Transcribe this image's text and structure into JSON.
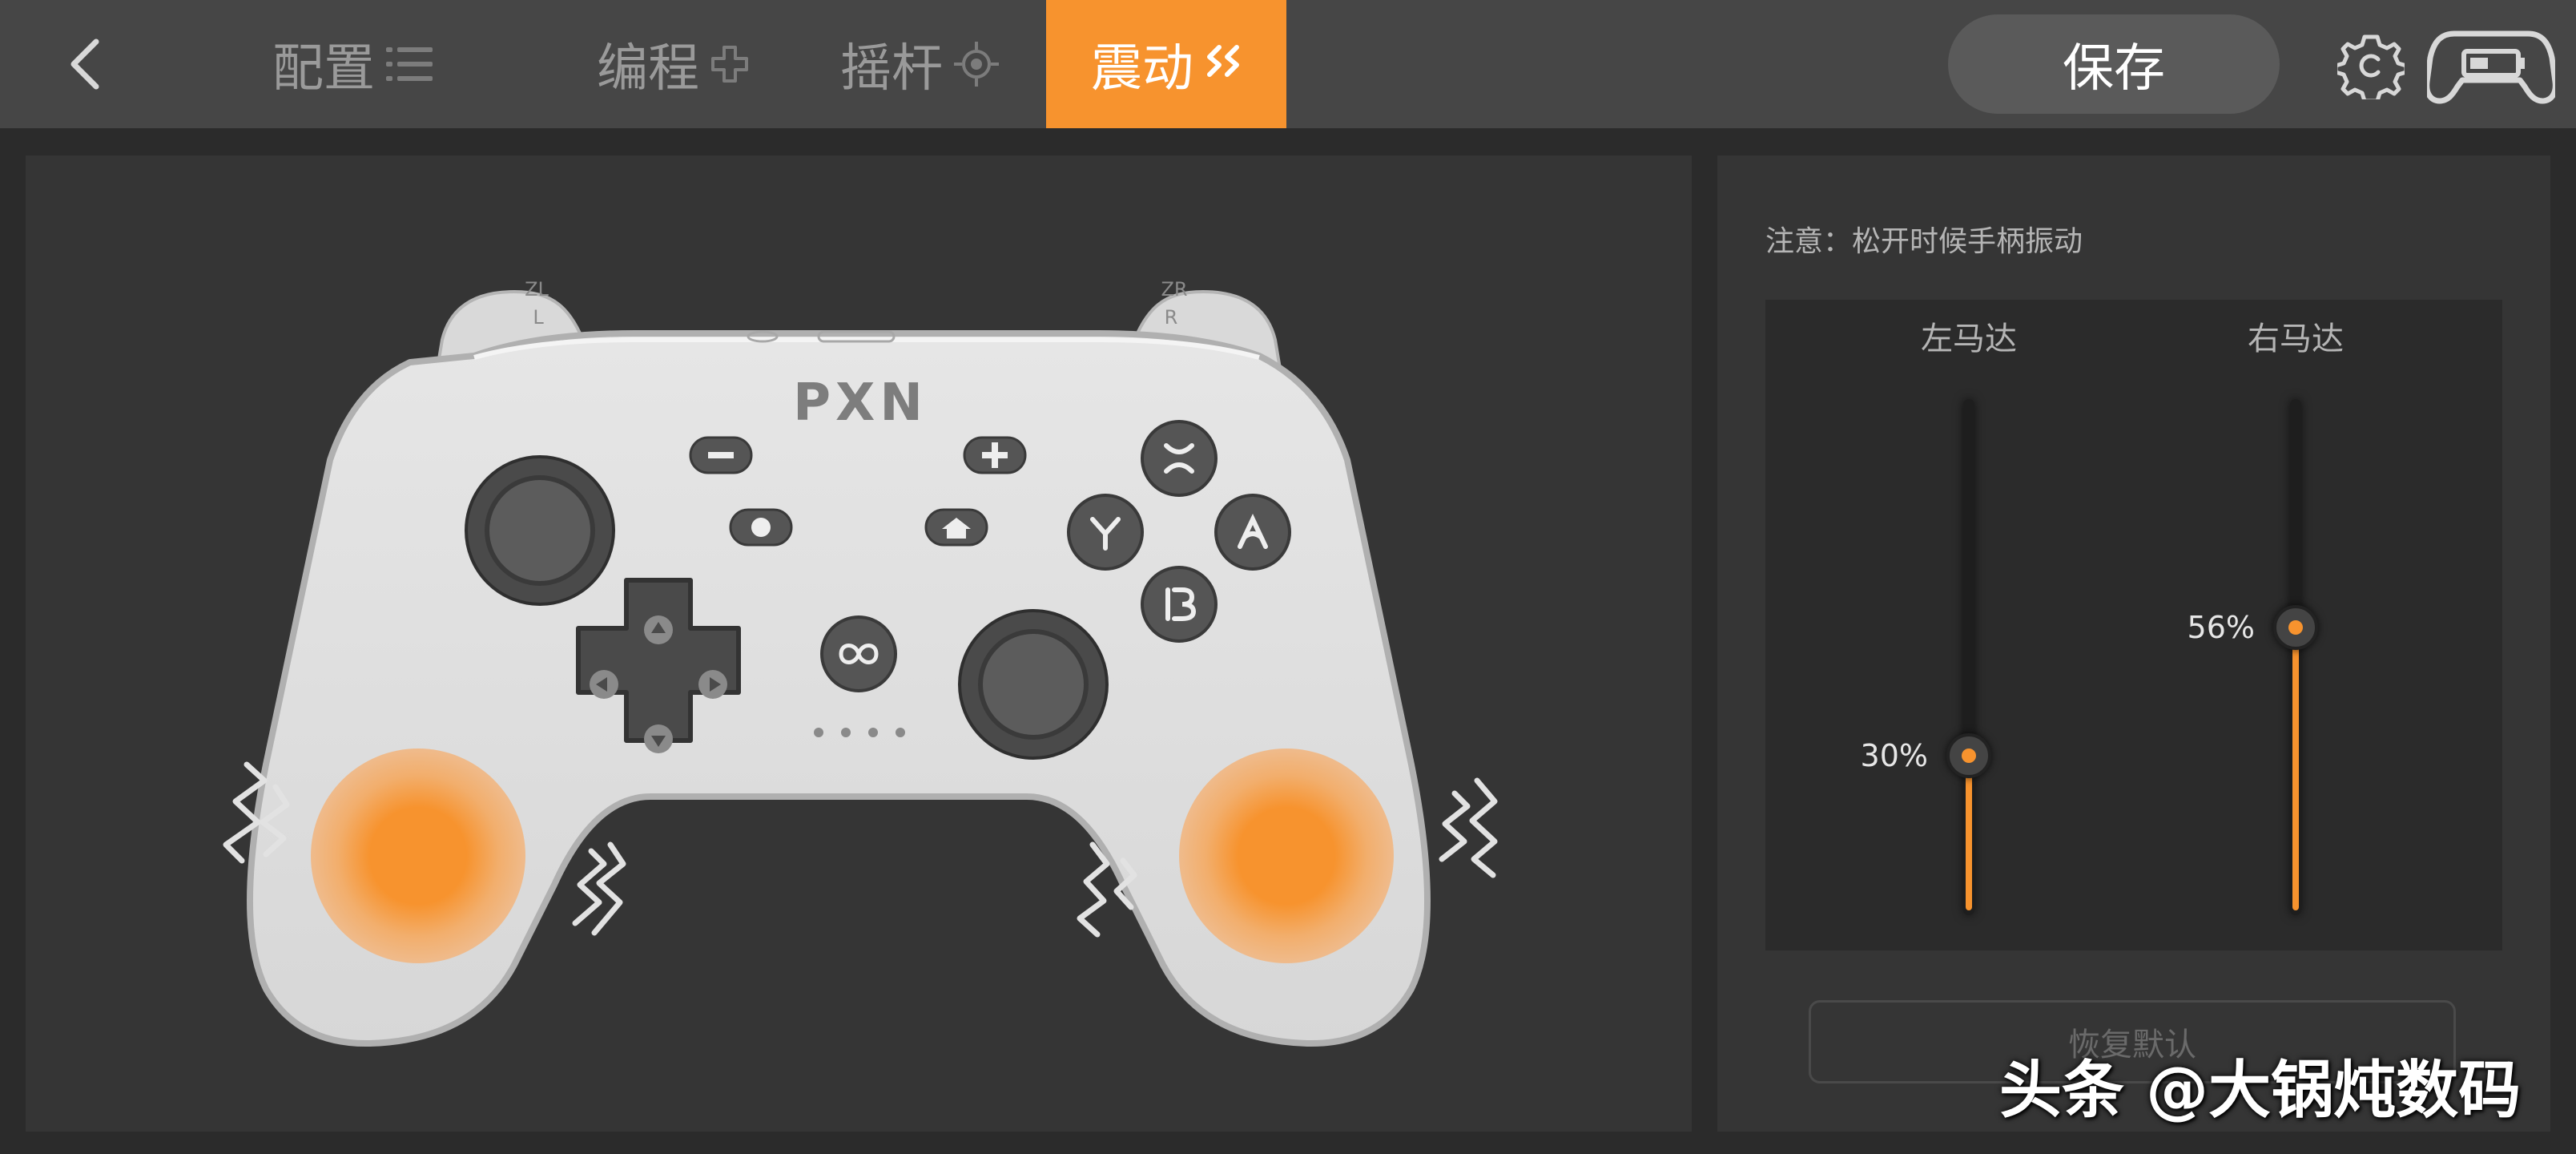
{
  "header": {
    "back_icon": "chevron-left-icon",
    "tabs": [
      {
        "label": "配置",
        "icon": "list-icon",
        "active": false
      },
      {
        "label": "编程",
        "icon": "plus-outline-icon",
        "active": false
      },
      {
        "label": "摇杆",
        "icon": "joystick-target-icon",
        "active": false
      },
      {
        "label": "震动",
        "icon": "vibration-icon",
        "active": true
      }
    ],
    "save_label": "保存",
    "settings_icon": "gear-c-icon",
    "controller_icon": "gamepad-icon"
  },
  "controller": {
    "brand": "PXN",
    "shoulder_left_top": "ZL",
    "shoulder_left_bottom": "L",
    "shoulder_right_top": "ZR",
    "shoulder_right_bottom": "R",
    "face_buttons": [
      "X",
      "Y",
      "A",
      "B"
    ]
  },
  "settings": {
    "note": "注意：松开时候手柄振动",
    "left_motor": {
      "label": "左马达",
      "value": 30,
      "display": "30%"
    },
    "right_motor": {
      "label": "右马达",
      "value": 56,
      "display": "56%"
    },
    "reset_label": "恢复默认"
  },
  "watermark": "头条 @大锅炖数码",
  "colors": {
    "accent": "#f7932e",
    "background": "#2b2b2b",
    "panel": "#353535",
    "header": "#464646"
  }
}
